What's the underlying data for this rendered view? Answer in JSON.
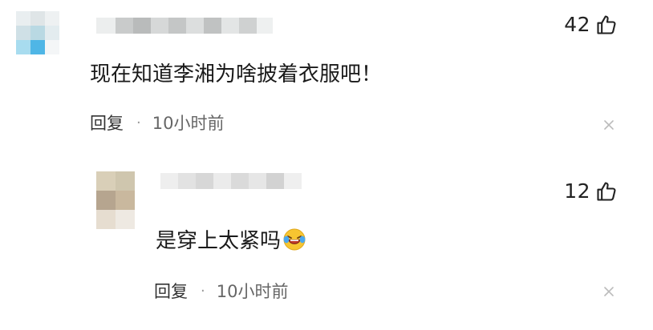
{
  "comments": [
    {
      "like_count": "42",
      "text": "现在知道李湘为啥披着衣服吧！",
      "reply_label": "回复",
      "separator": "·",
      "time": "10小时前"
    },
    {
      "like_count": "12",
      "text": "是穿上太紧吗",
      "reply_label": "回复",
      "separator": "·",
      "time": "10小时前"
    }
  ],
  "icons": {
    "like": "thumbs-up-outline",
    "emoji": "laughing-crying-face",
    "close": "x"
  },
  "colors": {
    "background": "#ffffff",
    "text": "#1a1a1a",
    "meta": "#666666",
    "close": "#bbbbbb"
  }
}
